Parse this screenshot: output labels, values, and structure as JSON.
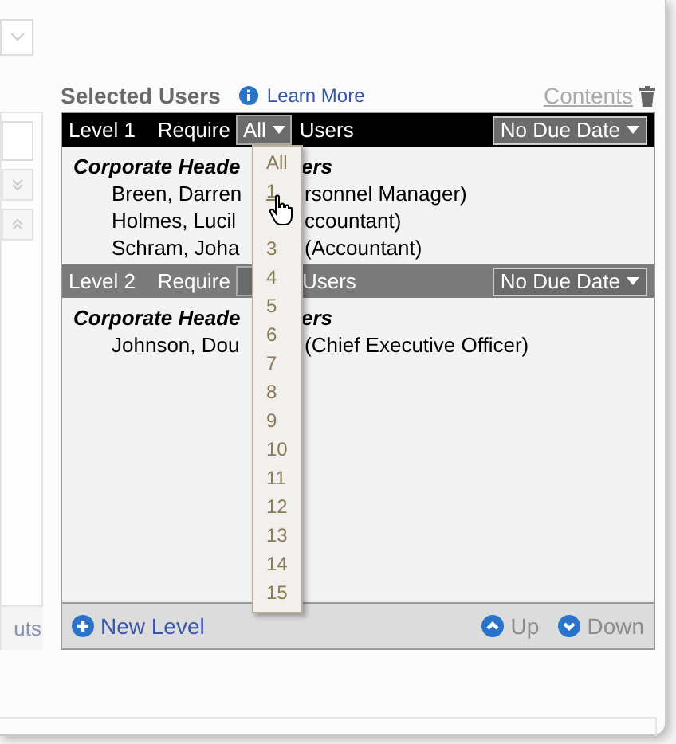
{
  "header": {
    "title": "Selected Users",
    "learn_more": "Learn More",
    "contents": "Contents"
  },
  "levels": [
    {
      "label": "Level 1",
      "require": "Require",
      "count": "All",
      "users": "Users",
      "due": "No Due Date",
      "dark": true,
      "groups": [
        {
          "name_left": "Corporate Heade",
          "name_right": "ers",
          "members": [
            {
              "left": "Breen, Darren",
              "right": "rsonnel Manager)"
            },
            {
              "left": "Holmes, Lucil",
              "right": "ccountant)"
            },
            {
              "left": "Schram, Joha",
              "right": "(Accountant)"
            }
          ]
        }
      ]
    },
    {
      "label": "Level 2",
      "require": "Require",
      "users": "Users",
      "due": "No Due Date",
      "dark": false,
      "groups": [
        {
          "name_left": "Corporate Heade",
          "name_right": "ers",
          "members": [
            {
              "left": "Johnson, Dou",
              "right": "(Chief Executive Officer)"
            }
          ]
        }
      ]
    }
  ],
  "dropdown": {
    "options": [
      {
        "label": "All",
        "hovered": false
      },
      {
        "label": "1",
        "hovered": true
      },
      {
        "label": "3",
        "hovered": false
      },
      {
        "label": "4",
        "hovered": false
      },
      {
        "label": "5",
        "hovered": false
      },
      {
        "label": "6",
        "hovered": false
      },
      {
        "label": "7",
        "hovered": false
      },
      {
        "label": "8",
        "hovered": false
      },
      {
        "label": "9",
        "hovered": false
      },
      {
        "label": "10",
        "hovered": false
      },
      {
        "label": "11",
        "hovered": false
      },
      {
        "label": "12",
        "hovered": false
      },
      {
        "label": "13",
        "hovered": false
      },
      {
        "label": "14",
        "hovered": false
      },
      {
        "label": "15",
        "hovered": false
      }
    ]
  },
  "footer": {
    "new_level": "New Level",
    "up": "Up",
    "down": "Down"
  },
  "left_panel": {
    "button": "uts"
  }
}
